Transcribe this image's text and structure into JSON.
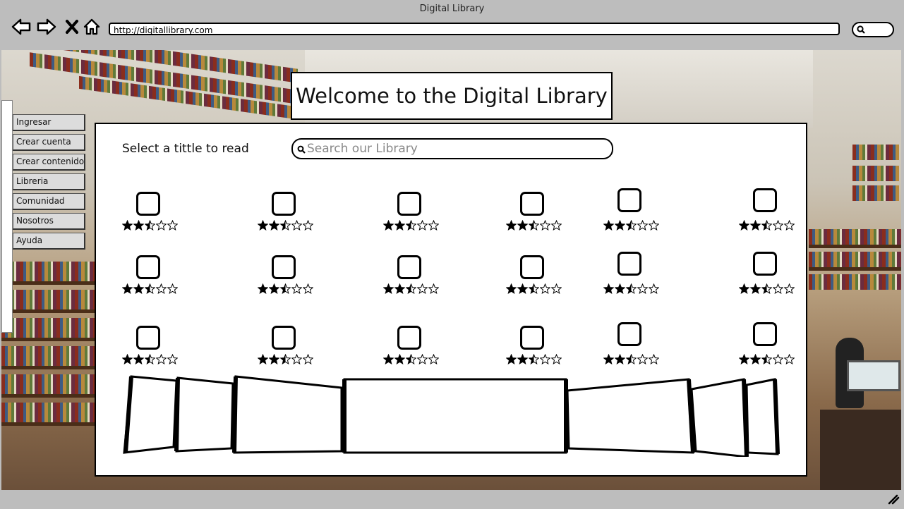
{
  "window": {
    "title": "Digital Library"
  },
  "toolbar": {
    "back_icon": "back-arrow-icon",
    "forward_icon": "forward-arrow-icon",
    "stop_icon": "close-icon",
    "home_icon": "home-icon",
    "address": "http://digitallibrary.com",
    "search_icon": "search-icon"
  },
  "banner": {
    "title": "Welcome to the Digital Library"
  },
  "sidebar": {
    "items": [
      {
        "label": "Ingresar"
      },
      {
        "label": "Crear cuenta"
      },
      {
        "label": "Crear contenido"
      },
      {
        "label": "Libreria"
      },
      {
        "label": "Comunidad"
      },
      {
        "label": "Nosotros"
      },
      {
        "label": "Ayuda"
      }
    ]
  },
  "main": {
    "prompt": "Select a tittle to read",
    "search_placeholder": "Search our Library"
  },
  "books": {
    "rows": 3,
    "columns": 6,
    "rating": 2.5,
    "max_rating": 5
  },
  "colors": {
    "accent": "#000000",
    "panel": "#ffffff",
    "chrome": "#bdbdbd"
  }
}
